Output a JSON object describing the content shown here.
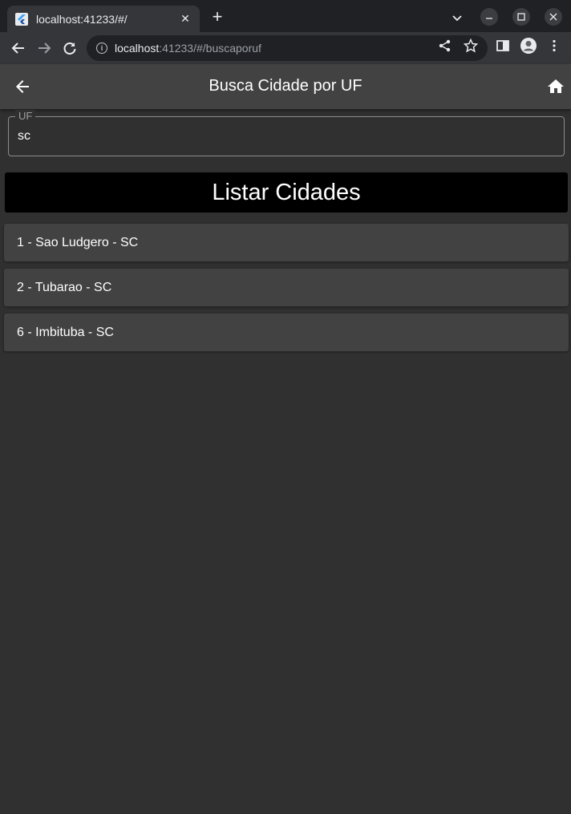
{
  "browser": {
    "tab_title": "localhost:41233/#/",
    "tab_close": "✕",
    "new_tab": "+",
    "url_host": "localhost",
    "url_rest": ":41233/#/buscaporuf"
  },
  "appbar": {
    "title": "Busca Cidade por UF"
  },
  "form": {
    "uf_label": "UF",
    "uf_value": "sc",
    "list_button": "Listar Cidades"
  },
  "cities": [
    "1 - Sao Ludgero - SC",
    "2 - Tubarao - SC",
    "6 - Imbituba - SC"
  ],
  "icons": {
    "back": "arrow-back-icon",
    "home": "home-icon"
  },
  "colors": {
    "background": "#303030",
    "appbar": "#424242",
    "button": "#000000",
    "list_item": "#424242"
  }
}
